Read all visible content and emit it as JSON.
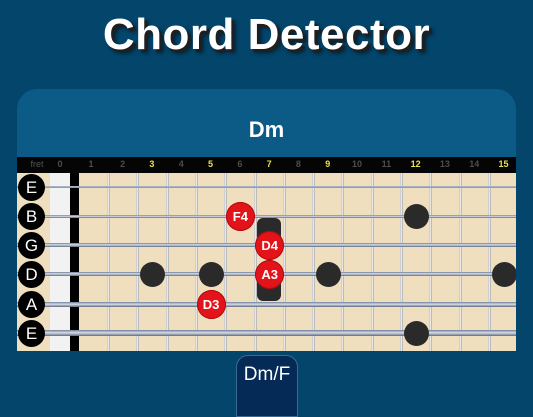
{
  "app": {
    "title": "Chord Detector"
  },
  "chord": {
    "name": "Dm"
  },
  "fret_header": {
    "label": "fret",
    "numbers": [
      "0",
      "1",
      "2",
      "3",
      "4",
      "5",
      "6",
      "7",
      "8",
      "9",
      "10",
      "11",
      "12",
      "13",
      "14",
      "15"
    ],
    "marked": [
      "3",
      "5",
      "7",
      "9",
      "12",
      "15"
    ]
  },
  "strings": [
    "E",
    "B",
    "G",
    "D",
    "A",
    "E"
  ],
  "inlay_markers": [
    {
      "string": "B",
      "fret": 12
    },
    {
      "string": "D",
      "fret": 3
    },
    {
      "string": "D",
      "fret": 5
    },
    {
      "string": "D",
      "fret": 9
    },
    {
      "string": "D",
      "fret": 15
    },
    {
      "string": "E",
      "fret": 12
    }
  ],
  "notes": [
    {
      "label": "F4",
      "string": "B",
      "fret": 6
    },
    {
      "label": "D4",
      "string": "G",
      "fret": 7
    },
    {
      "label": "A3",
      "string": "D",
      "fret": 7
    },
    {
      "label": "D3",
      "string": "A",
      "fret": 5
    }
  ],
  "variants": [
    "Dm/F"
  ],
  "colors": {
    "background": "#03456b",
    "panel": "#0c5a86",
    "note": "#e3131a",
    "marked_fret_number": "#e9e24a"
  }
}
